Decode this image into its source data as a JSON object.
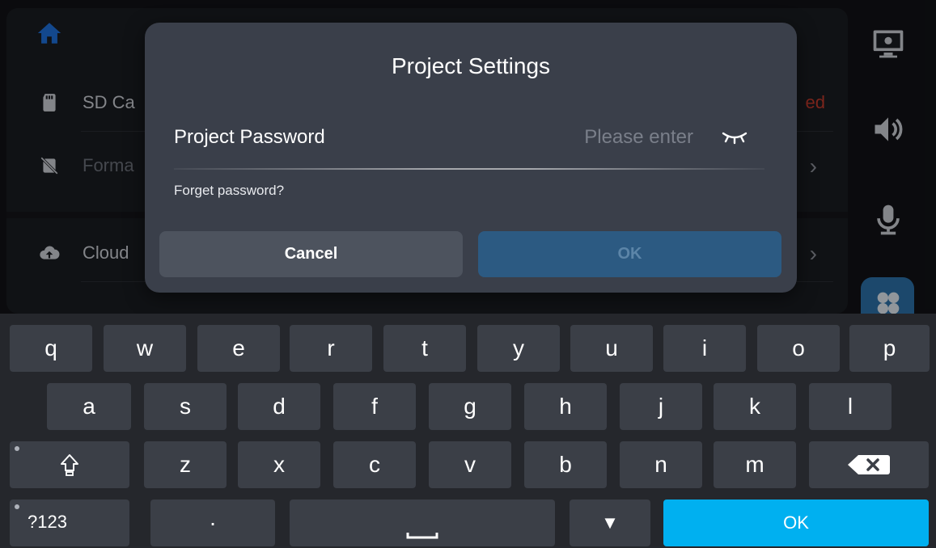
{
  "background": {
    "rows": [
      {
        "label": "SD Ca",
        "status": "ed"
      },
      {
        "label": "Forma",
        "chevron": "›"
      },
      {
        "label": "Cloud",
        "chevron": "›"
      }
    ],
    "icons": {
      "home": "home-icon",
      "sd": "sd-card-icon",
      "format": "format-card-icon",
      "cloud": "cloud-upload-icon",
      "display": "display-brightness-icon",
      "volume": "volume-icon",
      "mic": "microphone-icon",
      "apps": "apps-icon"
    }
  },
  "dialog": {
    "title": "Project Settings",
    "password_label": "Project Password",
    "password_placeholder": "Please enter",
    "password_value": "",
    "forget_link": "Forget password?",
    "cancel_label": "Cancel",
    "ok_label": "OK"
  },
  "keyboard": {
    "row1": [
      "q",
      "w",
      "e",
      "r",
      "t",
      "y",
      "u",
      "i",
      "o",
      "p"
    ],
    "row2": [
      "a",
      "s",
      "d",
      "f",
      "g",
      "h",
      "j",
      "k",
      "l"
    ],
    "row3": [
      "z",
      "x",
      "c",
      "v",
      "b",
      "n",
      "m"
    ],
    "symbols_label": "?123",
    "period_label": "·",
    "hide_label": "▼",
    "ok_label": "OK"
  },
  "colors": {
    "dialog_bg": "#3a3f4a",
    "ok_disabled": "#2c5a82",
    "keyboard_ok": "#00b0f0",
    "status_red": "#c0392b"
  }
}
